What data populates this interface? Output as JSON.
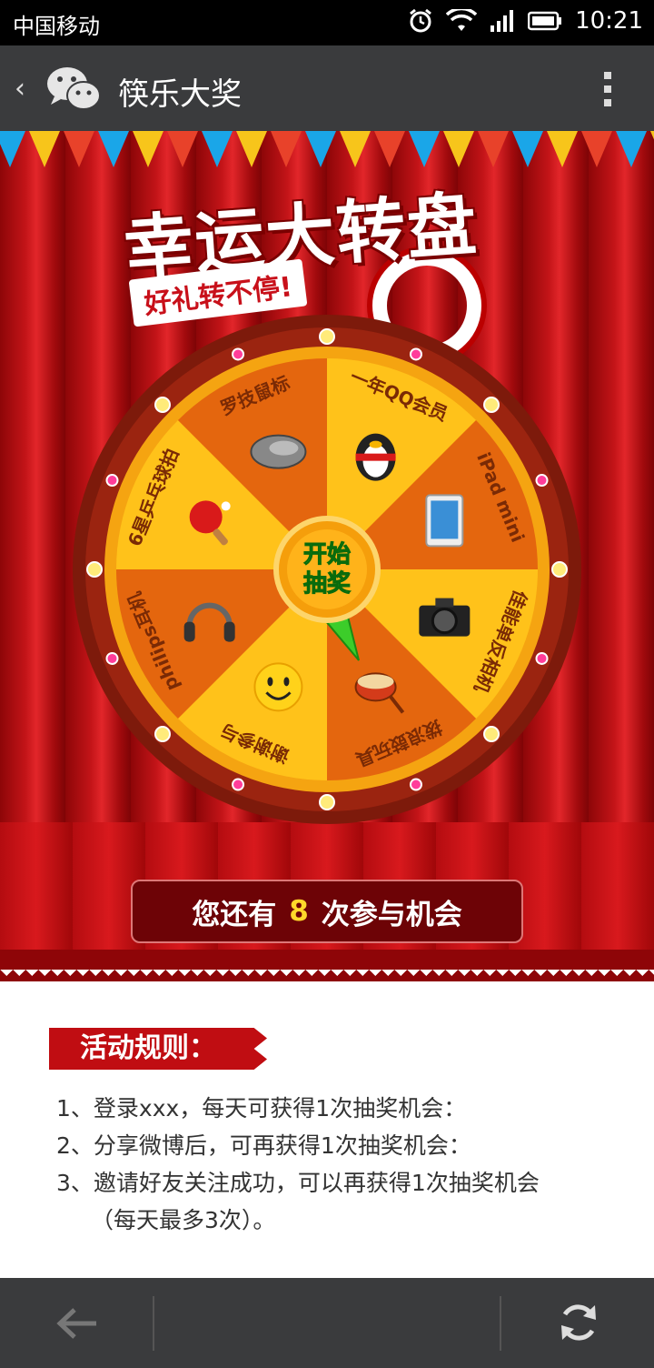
{
  "status_bar": {
    "carrier": "中国移动",
    "time": "10:21"
  },
  "title_bar": {
    "title": "筷乐大奖"
  },
  "headline": {
    "main": "幸运大转盘",
    "sub": "好礼转不停!"
  },
  "wheel": {
    "center_button": [
      "开始",
      "抽奖"
    ],
    "prizes": [
      {
        "label": "一年QQ会员",
        "icon": "qq-penguin-icon"
      },
      {
        "label": "iPad mini",
        "icon": "tablet-icon"
      },
      {
        "label": "佳能单反相机",
        "icon": "camera-icon"
      },
      {
        "label": "拨浪鼓玩具",
        "icon": "drum-toy-icon"
      },
      {
        "label": "谢谢参与",
        "icon": "smiley-icon"
      },
      {
        "label": "philips耳机",
        "icon": "headphones-icon"
      },
      {
        "label": "6星乒乓球拍",
        "icon": "ping-pong-paddle-icon"
      },
      {
        "label": "罗技鼠标",
        "icon": "mouse-icon"
      }
    ],
    "colors": {
      "light": "#ffc21a",
      "dark": "#e4660e",
      "rim": "#7d1a0b"
    }
  },
  "chances": {
    "prefix": "您还有",
    "count": "8",
    "suffix": "次参与机会"
  },
  "rules": {
    "heading": "活动规则：",
    "items": [
      "1、登录xxx，每天可获得1次抽奖机会：",
      "2、分享微博后，可再获得1次抽奖机会：",
      "3、邀请好友关注成功，可以再获得1次抽奖机会"
    ],
    "continuation": "（每天最多3次）。"
  }
}
